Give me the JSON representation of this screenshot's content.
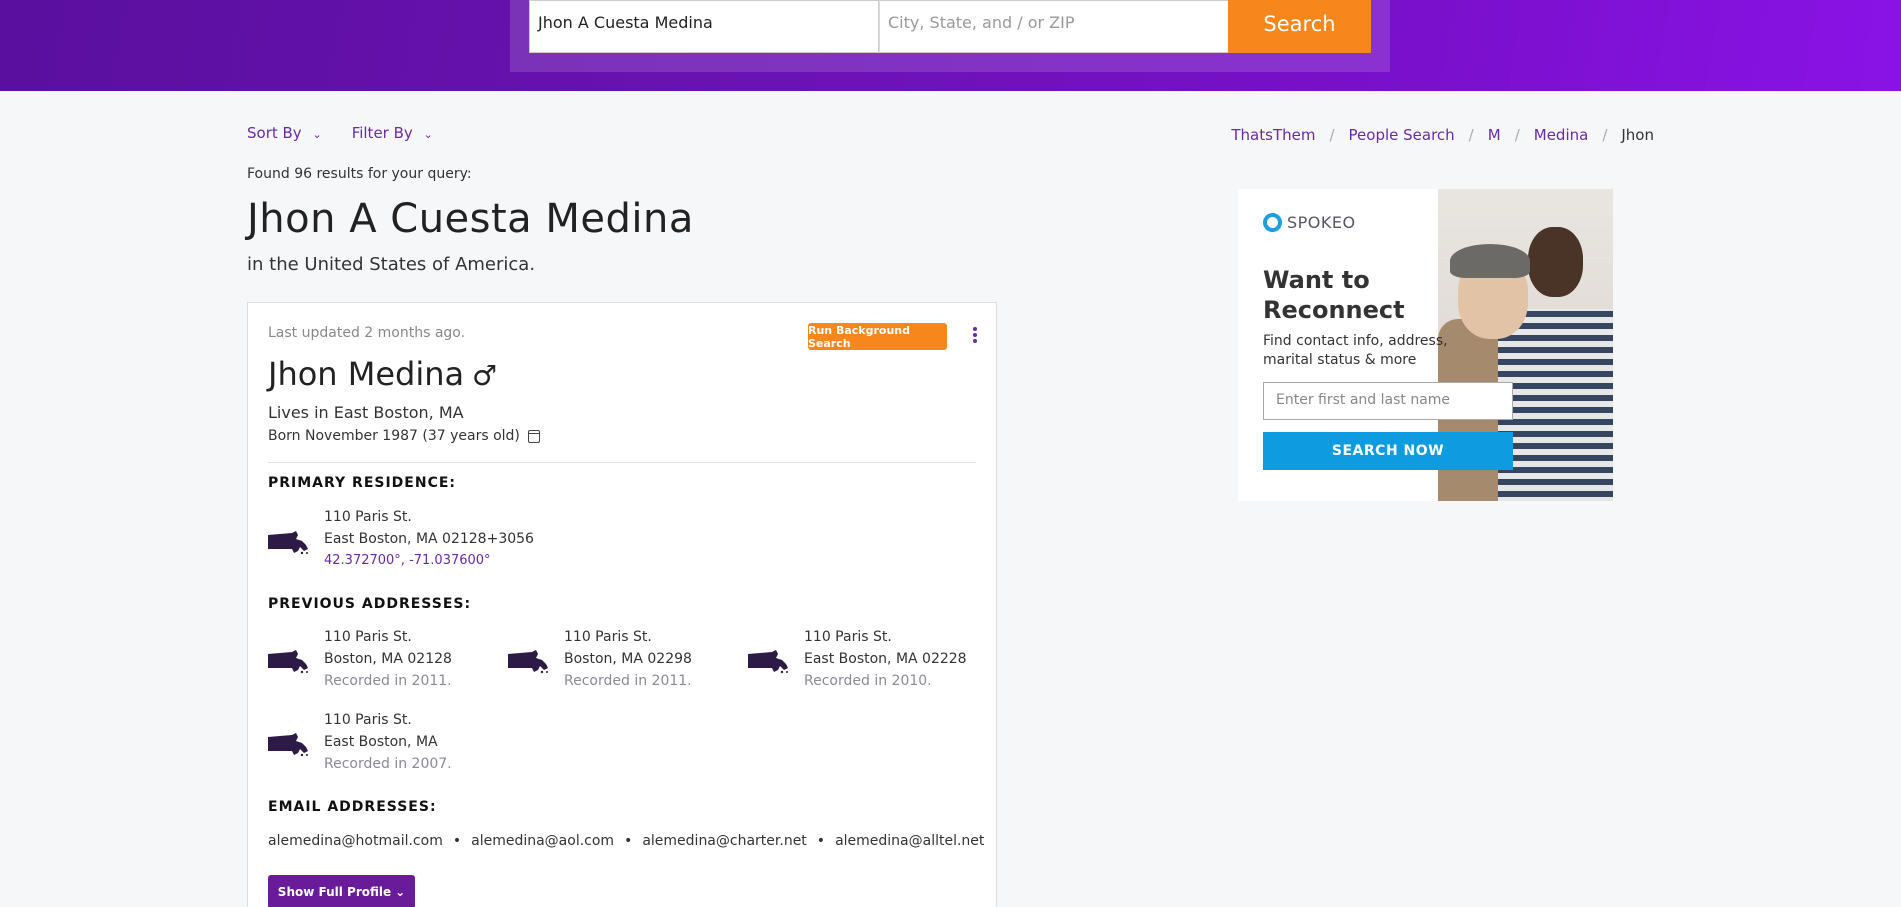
{
  "colors": {
    "brand_purple": "#6b2aa5",
    "header_gradient_start": "#5a0f9e",
    "header_gradient_end": "#8a12e6",
    "orange": "#f7861c",
    "spokeo_blue": "#0f9be0"
  },
  "search": {
    "name_value": "Jhon A Cuesta Medina",
    "location_placeholder": "City, State, and / or ZIP",
    "button_label": "Search"
  },
  "toolbar": {
    "sort_label": "Sort By",
    "filter_label": "Filter By",
    "chevron_icon": "chevron-down-icon"
  },
  "breadcrumb": {
    "items": [
      "ThatsThem",
      "People Search",
      "M",
      "Medina",
      "Jhon"
    ],
    "separator": "/"
  },
  "results": {
    "found_text": "Found 96 results for your query:",
    "query_title": "Jhon A Cuesta Medina",
    "query_subtitle": "in the United States of America."
  },
  "card": {
    "last_updated": "Last updated 2 months ago.",
    "background_button": "Run Background Search",
    "kebab_icon": "more-vertical-icon",
    "name": "Jhon Medina",
    "gender_symbol": "♂",
    "lives_in": "Lives in East Boston, MA",
    "born": "Born November 1987 (37 years old)",
    "calendar_icon": "calendar-icon",
    "primary_title": "PRIMARY RESIDENCE:",
    "primary": {
      "line1": "110 Paris St.",
      "line2": "East Boston, MA 02128+3056",
      "coords": "42.372700°, -71.037600°",
      "state_icon": "massachusetts-map-icon"
    },
    "previous_title": "PREVIOUS ADDRESSES:",
    "previous": [
      {
        "line1": "110 Paris St.",
        "line2": "Boston, MA 02128",
        "recorded": "Recorded in 2011."
      },
      {
        "line1": "110 Paris St.",
        "line2": "Boston, MA 02298",
        "recorded": "Recorded in 2011."
      },
      {
        "line1": "110 Paris St.",
        "line2": "East Boston, MA 02228",
        "recorded": "Recorded in 2010."
      },
      {
        "line1": "110 Paris St.",
        "line2": "East Boston, MA",
        "recorded": "Recorded in 2007."
      }
    ],
    "email_title": "EMAIL ADDRESSES:",
    "emails": [
      "alemedina@hotmail.com",
      "alemedina@aol.com",
      "alemedina@charter.net",
      "alemedina@alltel.net"
    ],
    "email_separator": "•",
    "full_profile_button": "Show Full Profile",
    "full_profile_chevron": "⌄"
  },
  "ad": {
    "brand": "SPOKEO",
    "title": "Want to Reconnect",
    "description": "Find contact info, address, marital status & more",
    "input_placeholder": "Enter first and last name",
    "button_label": "SEARCH NOW"
  }
}
